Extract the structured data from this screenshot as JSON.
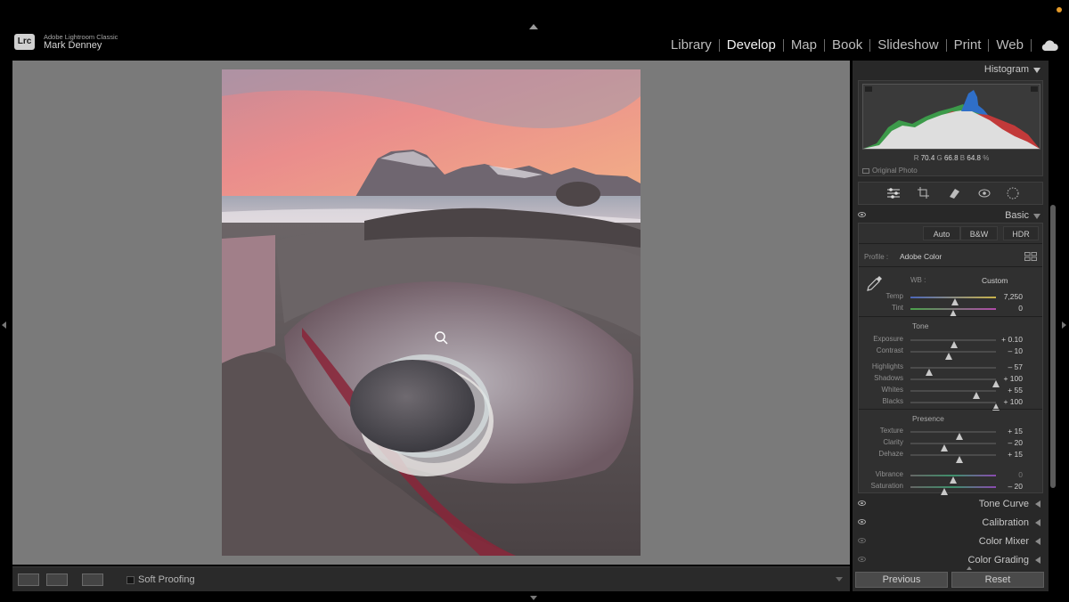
{
  "header": {
    "logo_text": "Lrc",
    "app_name": "Adobe Lightroom Classic",
    "user_name": "Mark Denney",
    "modules": [
      {
        "label": "Library"
      },
      {
        "label": "Develop"
      },
      {
        "label": "Map"
      },
      {
        "label": "Book"
      },
      {
        "label": "Slideshow"
      },
      {
        "label": "Print"
      },
      {
        "label": "Web"
      }
    ],
    "active_module": "Develop"
  },
  "toolbar": {
    "soft_proofing_label": "Soft Proofing"
  },
  "histogram": {
    "title": "Histogram",
    "r_label": "R",
    "r_value": "70.4",
    "g_label": "G",
    "g_value": "66.8",
    "b_label": "B",
    "b_value": "64.8",
    "unit": "%",
    "original_photo_label": "Original Photo"
  },
  "basic": {
    "title": "Basic",
    "buttons": [
      "Auto",
      "B&W",
      "HDR"
    ],
    "profile_label": "Profile :",
    "profile_value": "Adobe Color",
    "wb_label": "WB :",
    "wb_value": "Custom",
    "tone_title": "Tone",
    "presence_title": "Presence",
    "sliders": {
      "temp": {
        "label": "Temp",
        "value": "7,250",
        "pos": 0.52
      },
      "tint": {
        "label": "Tint",
        "value": "0",
        "pos": 0.5
      },
      "exposure": {
        "label": "Exposure",
        "value": "+ 0.10",
        "pos": 0.51
      },
      "contrast": {
        "label": "Contrast",
        "value": "– 10",
        "pos": 0.45
      },
      "highlights": {
        "label": "Highlights",
        "value": "– 57",
        "pos": 0.22
      },
      "shadows": {
        "label": "Shadows",
        "value": "+ 100",
        "pos": 1.0
      },
      "whites": {
        "label": "Whites",
        "value": "+ 55",
        "pos": 0.77
      },
      "blacks": {
        "label": "Blacks",
        "value": "+ 100",
        "pos": 1.0
      },
      "texture": {
        "label": "Texture",
        "value": "+ 15",
        "pos": 0.57
      },
      "clarity": {
        "label": "Clarity",
        "value": "– 20",
        "pos": 0.4
      },
      "dehaze": {
        "label": "Dehaze",
        "value": "+ 15",
        "pos": 0.57
      },
      "vibrance": {
        "label": "Vibrance",
        "value": "0",
        "pos": 0.5
      },
      "saturation": {
        "label": "Saturation",
        "value": "– 20",
        "pos": 0.4
      }
    }
  },
  "panels": {
    "tone_curve": "Tone Curve",
    "calibration": "Calibration",
    "color_mixer": "Color Mixer",
    "color_grading": "Color Grading"
  },
  "buttons": {
    "previous": "Previous",
    "reset": "Reset"
  }
}
